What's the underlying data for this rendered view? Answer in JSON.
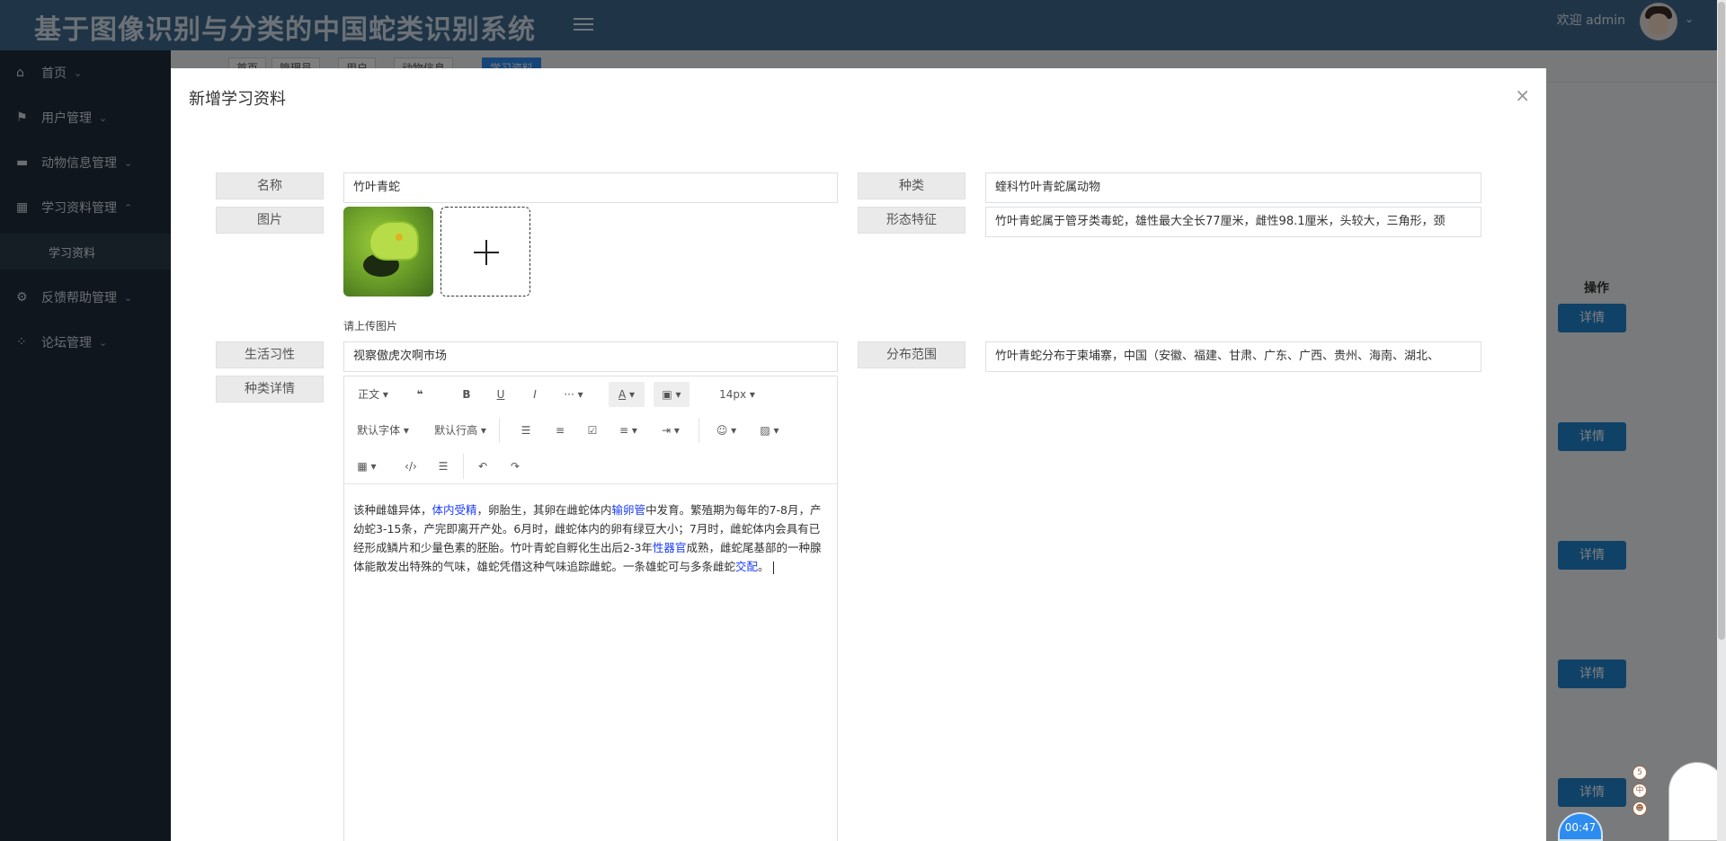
{
  "header": {
    "system_title": "基于图像识别与分类的中国蛇类识别系统",
    "welcome_text": "欢迎 admin"
  },
  "sidebar": {
    "items": [
      {
        "label": "首页",
        "icon": "home-icon"
      },
      {
        "label": "用户管理",
        "icon": "user-icon"
      },
      {
        "label": "动物信息管理",
        "icon": "animal-icon"
      },
      {
        "label": "学习资料管理",
        "icon": "book-icon"
      },
      {
        "label": "反馈帮助管理",
        "icon": "gear-icon"
      },
      {
        "label": "论坛管理",
        "icon": "forum-icon"
      }
    ],
    "active_sub": "学习资料"
  },
  "tabs": [
    "首页",
    "管理员",
    "用户",
    "动物信息",
    "学习资料"
  ],
  "table": {
    "operation_header": "操作",
    "detail_label": "详情"
  },
  "modal": {
    "title": "新增学习资料",
    "close": "×",
    "fields": {
      "name_label": "名称",
      "name_value": "竹叶青蛇",
      "species_label": "种类",
      "species_value": "蝰科竹叶青蛇属动物",
      "image_label": "图片",
      "upload_hint": "请上传图片",
      "morph_label": "形态特征",
      "morph_value": "竹叶青蛇属于管牙类毒蛇，雄性最大全长77厘米，雌性98.1厘米，头较大，三角形，颈",
      "habit_label": "生活习性",
      "habit_value": "视察傲虎次啊市场",
      "range_label": "分布范围",
      "range_value": "竹叶青蛇分布于柬埔寨，中国（安徽、福建、甘肃、广东、广西、贵州、海南、湖北、",
      "detail_label": "种类详情"
    },
    "editor": {
      "toolbar": {
        "paragraph": "正文",
        "font_size": "14px",
        "font_family": "默认字体",
        "line_height": "默认行高"
      },
      "content": {
        "p1": "该种雌雄异体，",
        "l1": "体内受精",
        "p2": "，卵胎生，其卵在雌蛇体内",
        "l2": "输卵管",
        "p3": "中发育。繁殖期为每年的7-8月，产幼蛇3-15条，产完即离开产处。6月时，雌蛇体内的卵有绿豆大小；7月时，雌蛇体内会具有已经形成鳞片和少量色素的胚胎。竹叶青蛇自孵化生出后2-3年",
        "l3": "性器官",
        "p4": "成熟，雌蛇尾基部的一种腺体能散发出特殊的气味，雄蛇凭借这种气味追踪雌蛇。一条雄蛇可与多条雌蛇",
        "l4": "交配",
        "p5": "。"
      }
    }
  },
  "widgets": {
    "timer": "00:47",
    "mini_icons": [
      "5",
      "中",
      "☻"
    ]
  },
  "colors": {
    "header_bg": "#3f6a8e",
    "sidebar_bg": "#1f2d3d",
    "primary_button": "#2185d0"
  }
}
